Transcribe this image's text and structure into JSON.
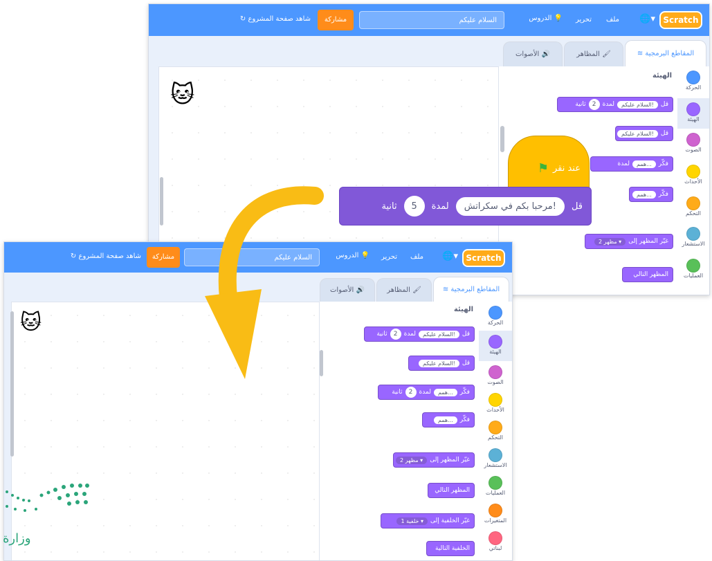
{
  "menubar": {
    "logo": "Scratch",
    "file": "ملف",
    "edit": "تحرير",
    "tutorials": "الدروس",
    "project_title": "السلام عليكم",
    "share": "مشاركة",
    "see_project_page": "شاهد صفحة المشروع"
  },
  "tabs": {
    "code": "المقاطع البرمجية",
    "costumes": "المظاهر",
    "sounds": "الأصوات"
  },
  "categories": [
    {
      "label": "الحركة",
      "color": "#4c97ff"
    },
    {
      "label": "الهيئة",
      "color": "#9966ff"
    },
    {
      "label": "الصوت",
      "color": "#cf63cf"
    },
    {
      "label": "الأحداث",
      "color": "#ffd500"
    },
    {
      "label": "التحكم",
      "color": "#ffab19"
    },
    {
      "label": "الاستشعار",
      "color": "#5cb1d6"
    },
    {
      "label": "العمليات",
      "color": "#59c059"
    },
    {
      "label": "المتغيرات",
      "color": "#ff8c1a"
    },
    {
      "label": "لبناتي",
      "color": "#ff6680"
    }
  ],
  "palette": {
    "heading": "الهيئة",
    "say": "قل",
    "think": "فكّر",
    "for": "لمدة",
    "seconds": "ثانية",
    "hello_value": "السلام عليكم!",
    "hmm_value": "همم...",
    "say_secs": "2",
    "switch_costume": "غيّر المظهر إلى",
    "costume_value": "مظهر 2",
    "next_costume": "المظهر التالي",
    "switch_backdrop": "غيّر الخلفية إلى",
    "backdrop_value": "خلفية 1",
    "next_backdrop": "الخلفية التالية"
  },
  "overlay": {
    "hat_label": "عند نقر",
    "say_label": "قل",
    "message": "مرحبا بكم في سكراتش!",
    "for": "لمدة",
    "secs": "5",
    "seconds": "ثانية"
  },
  "watermark": {
    "text": "وزارة"
  },
  "colors": {
    "menubar": "#4c97ff",
    "looks": "#9966ff",
    "events": "#ffbf00",
    "share": "#ff8c1a",
    "arrow": "#f9bc15"
  }
}
